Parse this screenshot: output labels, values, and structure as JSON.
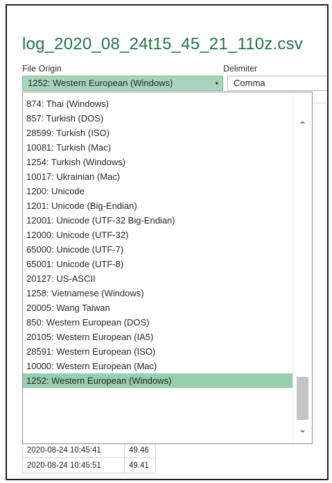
{
  "window": {
    "title": "log_2020_08_24t15_45_21_110z.csv"
  },
  "file_origin": {
    "label": "File Origin",
    "selected": "1252: Western European (Windows)",
    "options": [
      "874: Thai (Windows)",
      "857: Turkish (DOS)",
      "28599: Turkish (ISO)",
      "10081: Turkish (Mac)",
      "1254: Turkish (Windows)",
      "10017: Ukrainian (Mac)",
      "1200: Unicode",
      "1201: Unicode (Big-Endian)",
      "12001: Unicode (UTF-32 Big-Endian)",
      "12000: Unicode (UTF-32)",
      "65000: Unicode (UTF-7)",
      "65001: Unicode (UTF-8)",
      "20127: US-ASCII",
      "1258: Vietnamese (Windows)",
      "20005: Wang Taiwan",
      "850: Western European (DOS)",
      "20105: Western European (IA5)",
      "28591: Western European (ISO)",
      "10000: Western European (Mac)",
      "1252: Western European (Windows)"
    ],
    "selected_index": 19
  },
  "delimiter": {
    "label": "Delimiter",
    "value": "Comma"
  },
  "preview_rows": [
    [
      "2020-08-24 10:45:41",
      "49.46"
    ],
    [
      "2020-08-24 10:45:51",
      "49.41"
    ]
  ],
  "icons": {
    "dropdown_caret": "▾",
    "scroll_up": "⌃",
    "scroll_down": "⌄"
  },
  "colors": {
    "title": "#217346",
    "selected_field": "#a9d4bb",
    "selected_option": "#95cfae"
  }
}
